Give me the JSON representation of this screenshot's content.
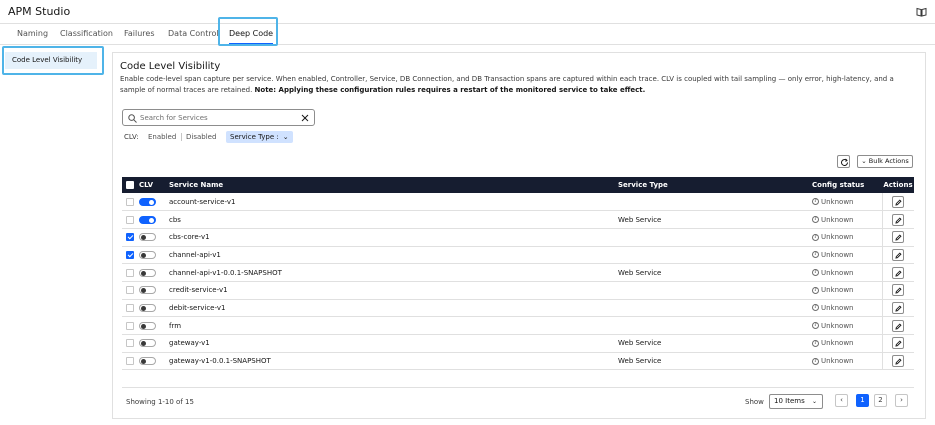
{
  "app": {
    "title": "APM Studio",
    "help_icon": "book-icon"
  },
  "tabs": [
    {
      "label": "Naming",
      "active": false
    },
    {
      "label": "Classification",
      "active": false
    },
    {
      "label": "Failures",
      "active": false
    },
    {
      "label": "Data Control",
      "active": false
    },
    {
      "label": "Deep Code",
      "active": true
    }
  ],
  "sidebar": {
    "items": [
      {
        "label": "Code Level Visibility",
        "active": true
      }
    ]
  },
  "section": {
    "title": "Code Level Visibility",
    "description": "Enable code-level span capture per service. When enabled, Controller, Service, DB Connection, and DB Transaction spans are captured within each trace. CLV is coupled with tail sampling — only error, high-latency, and a sample of normal traces are retained.",
    "note": "Note: Applying these configuration rules requires a restart of the monitored service to take effect."
  },
  "search": {
    "placeholder": "Search for Services",
    "value": ""
  },
  "filters": {
    "clv_label": "CLV:",
    "enabled_label": "Enabled",
    "disabled_label": "Disabled",
    "service_type_label": "Service Type :"
  },
  "toolbar": {
    "bulk_actions_label": "Bulk Actions"
  },
  "table": {
    "headers": {
      "clv": "CLV",
      "service_name": "Service Name",
      "service_type": "Service Type",
      "config_status": "Config status",
      "actions": "Actions"
    },
    "rows": [
      {
        "checked": false,
        "clv": true,
        "name": "account-service-v1",
        "type": "",
        "status": "Unknown"
      },
      {
        "checked": false,
        "clv": true,
        "name": "cbs",
        "type": "Web Service",
        "status": "Unknown"
      },
      {
        "checked": true,
        "clv": false,
        "name": "cbs-core-v1",
        "type": "",
        "status": "Unknown"
      },
      {
        "checked": true,
        "clv": false,
        "name": "channel-api-v1",
        "type": "",
        "status": "Unknown"
      },
      {
        "checked": false,
        "clv": false,
        "name": "channel-api-v1-0.0.1-SNAPSHOT",
        "type": "Web Service",
        "status": "Unknown"
      },
      {
        "checked": false,
        "clv": false,
        "name": "credit-service-v1",
        "type": "",
        "status": "Unknown"
      },
      {
        "checked": false,
        "clv": false,
        "name": "debit-service-v1",
        "type": "",
        "status": "Unknown"
      },
      {
        "checked": false,
        "clv": false,
        "name": "frm",
        "type": "",
        "status": "Unknown"
      },
      {
        "checked": false,
        "clv": false,
        "name": "gateway-v1",
        "type": "Web Service",
        "status": "Unknown"
      },
      {
        "checked": false,
        "clv": false,
        "name": "gateway-v1-0.0.1-SNAPSHOT",
        "type": "Web Service",
        "status": "Unknown"
      }
    ]
  },
  "pagination": {
    "showing_text": "Showing 1-10 of 15",
    "show_label": "Show",
    "page_size_value": "10 Items",
    "pages": [
      "1",
      "2"
    ],
    "current_page": "1"
  },
  "colors": {
    "accent": "#0f62fe",
    "header_bg": "#161d30",
    "highlight": "#4fb4e8"
  }
}
